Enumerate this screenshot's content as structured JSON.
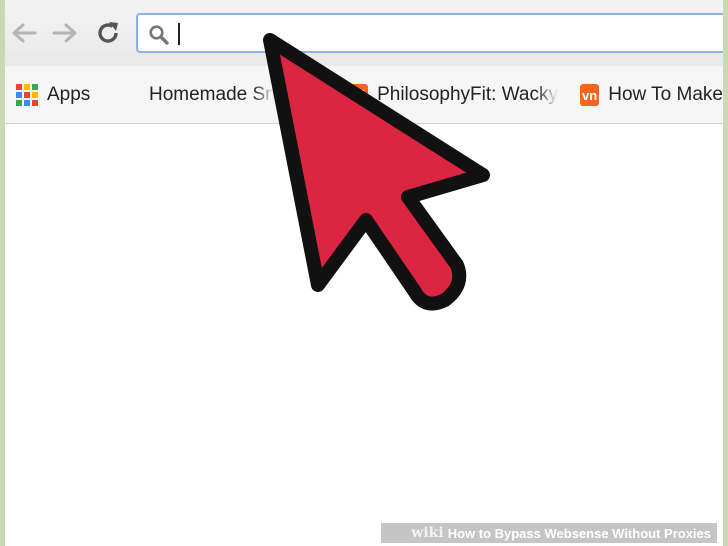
{
  "toolbar": {
    "back_icon": "back-arrow-icon",
    "forward_icon": "forward-arrow-icon",
    "reload_icon": "reload-icon",
    "omnibox_value": "",
    "search_icon": "search-icon"
  },
  "bookmarks": [
    {
      "label": "Apps",
      "icon": "apps-grid-icon"
    },
    {
      "label": "Homemade Sn",
      "icon": ""
    },
    {
      "label": "PhilosophyFit: Wacky",
      "icon": "philosophyfit-favicon",
      "color": "#f26522"
    },
    {
      "label": "How To Make",
      "icon": "vn-favicon",
      "badge": "vn",
      "color": "#f26522"
    }
  ],
  "overlay": {
    "icon": "mouse-pointer-icon",
    "color": "#dc2540"
  },
  "watermark": {
    "brand": "wiki",
    "text": "How to Bypass Websense Without Proxies"
  }
}
